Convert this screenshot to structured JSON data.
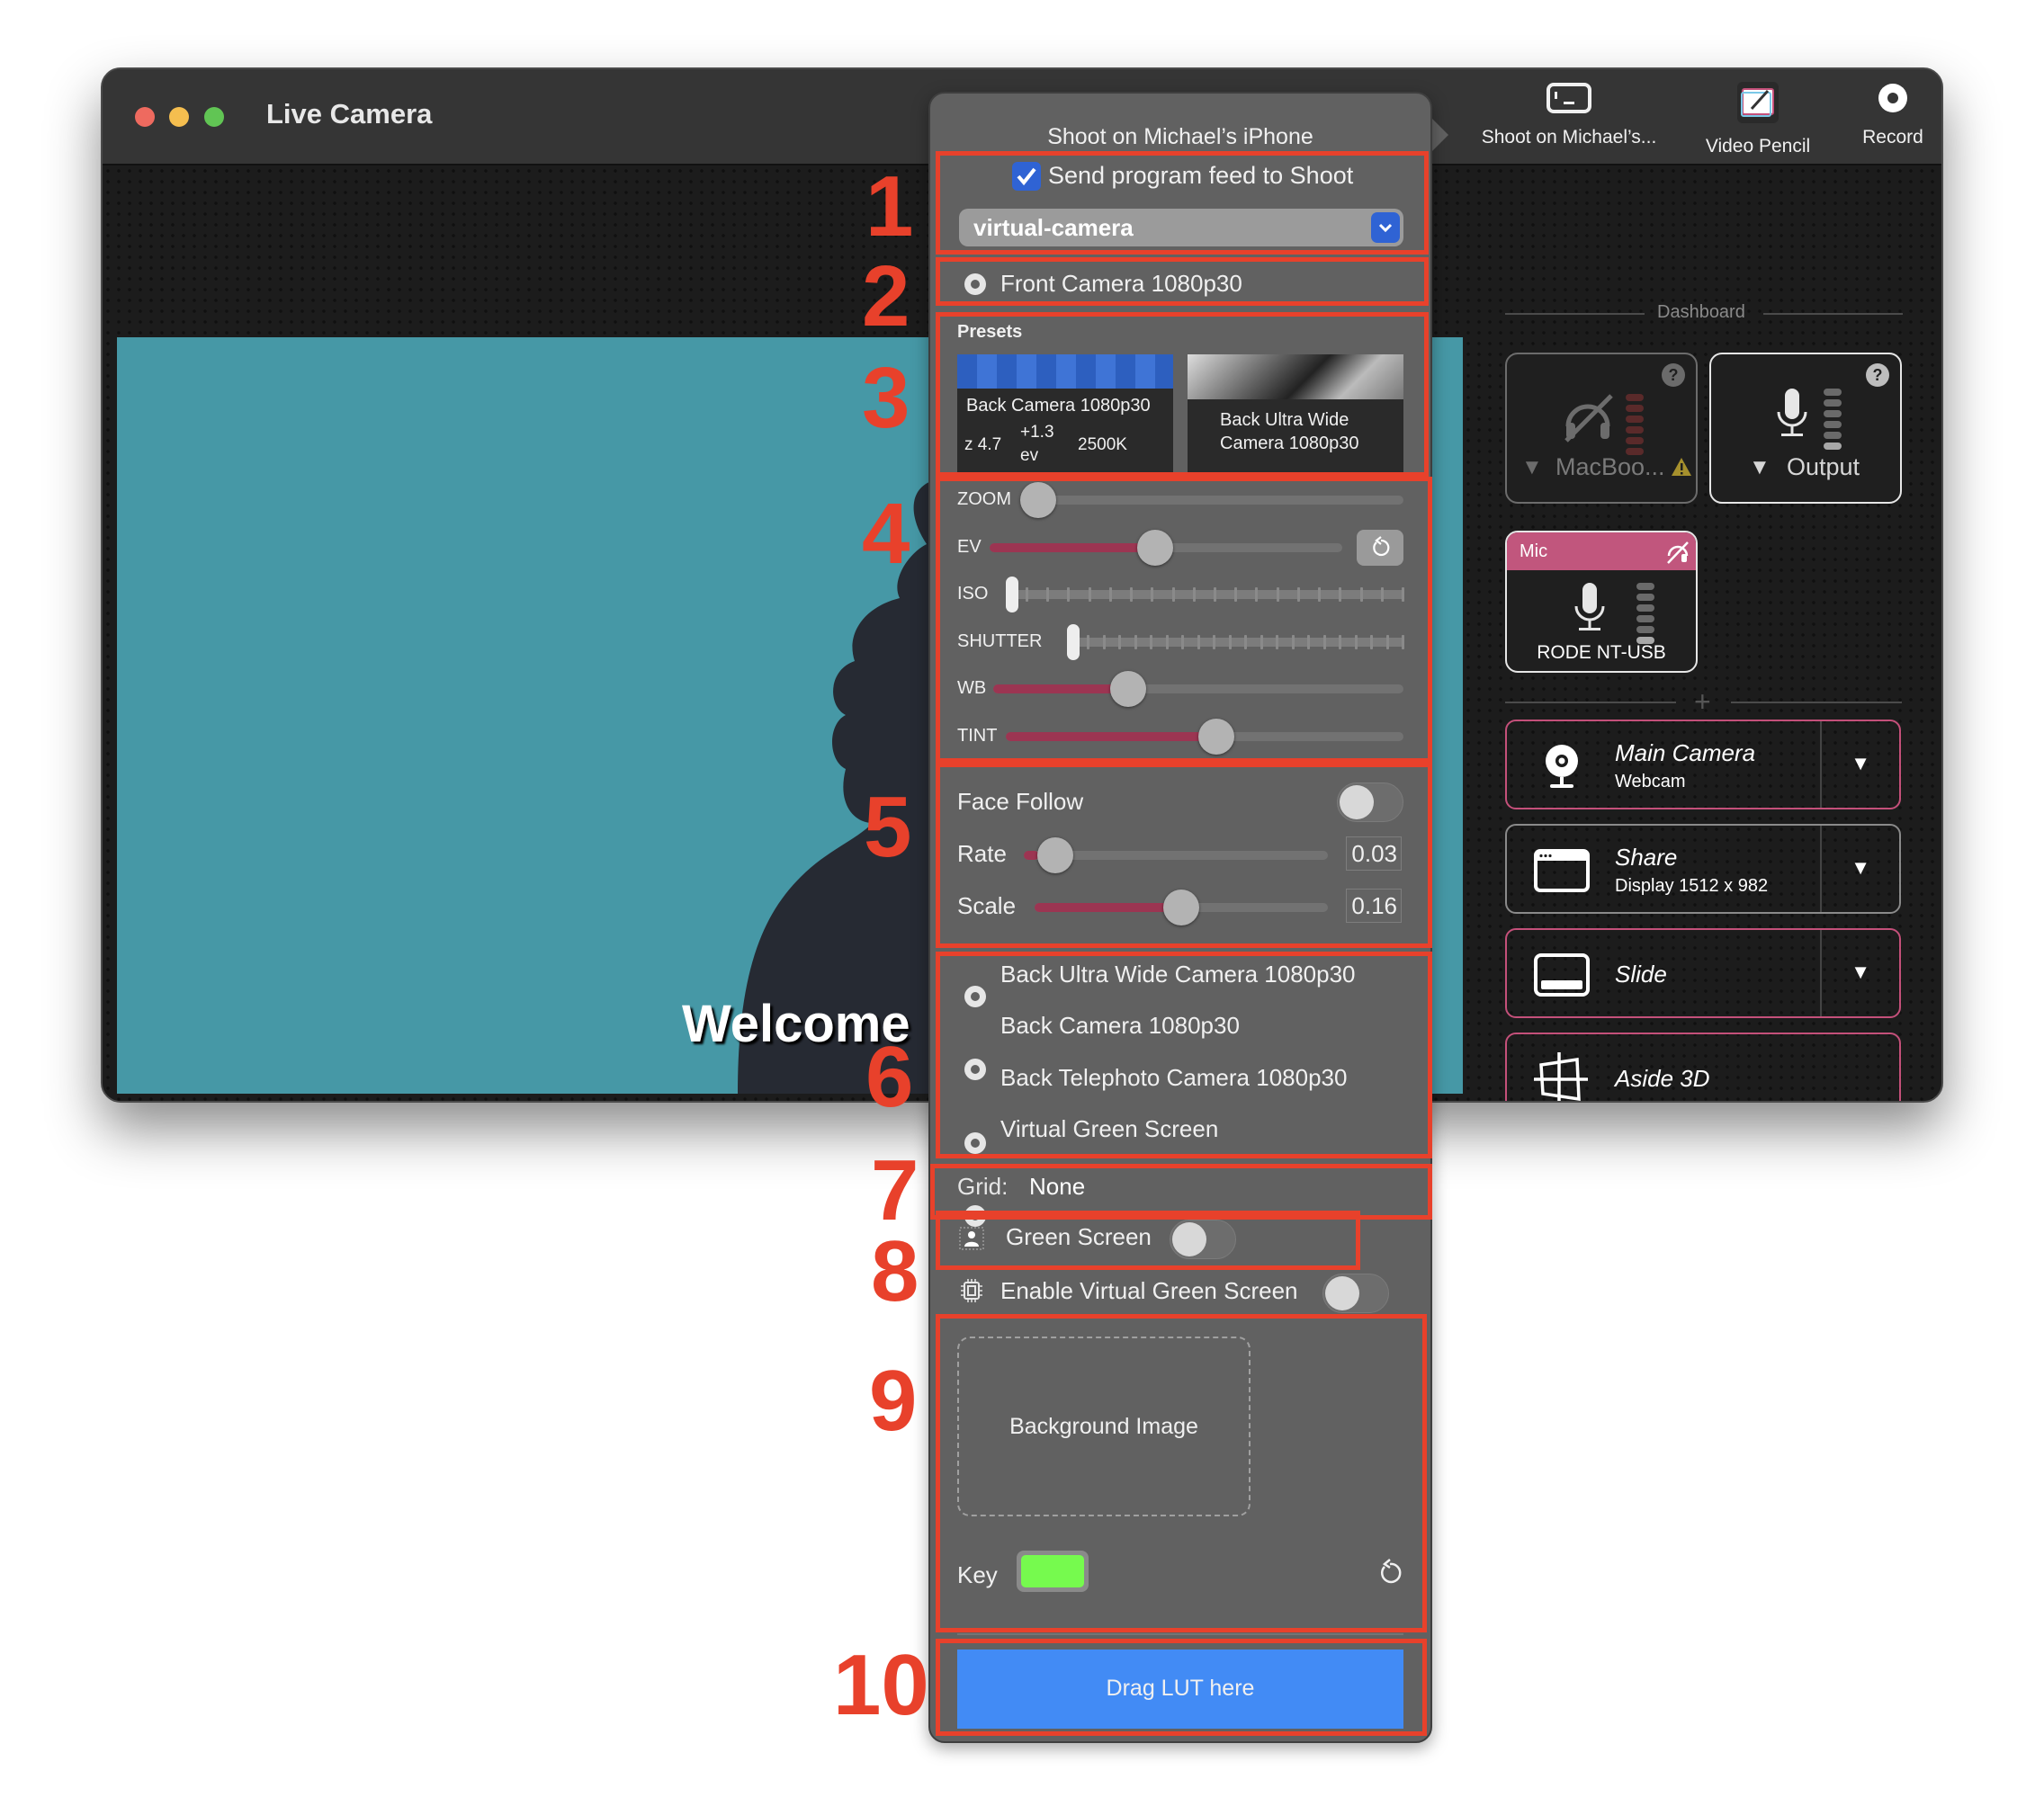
{
  "window": {
    "title": "Live Camera",
    "traffic_lights": {
      "close": "#ee6a5f",
      "minimize": "#f5be4f",
      "zoom": "#61c554"
    }
  },
  "toolbar": {
    "shoot": {
      "label": "Shoot on Michael’s...",
      "icon": "phone-landscape-icon"
    },
    "video_pencil": {
      "label": "Video Pencil",
      "icon": "video-pencil-icon"
    },
    "record": {
      "label": "Record",
      "icon": "record-icon"
    }
  },
  "preview": {
    "overlay_text": "Welcome",
    "background_color": "#4698a6",
    "silhouette_color": "#262a33"
  },
  "dashboard": {
    "header": "Dashboard",
    "audio_tiles": [
      {
        "name": "MacBoo...",
        "icon": "headphones-muted-icon",
        "warning": true,
        "help": "?",
        "state": "disabled"
      },
      {
        "name": "Output",
        "icon": "microphone-icon",
        "help": "?",
        "state": "active"
      }
    ],
    "mic_tile": {
      "header": "Mic",
      "device": "RODE NT-USB",
      "header_icon": "headphones-muted-icon"
    },
    "add_symbol": "+",
    "sources": [
      {
        "title": "Main Camera",
        "subtitle": "Webcam",
        "icon": "webcam-icon",
        "has_menu": true,
        "accent": "#c4507a"
      },
      {
        "title": "Share",
        "subtitle": "Display 1512 x 982",
        "icon": "window-icon",
        "has_menu": true,
        "accent": "#8a8a8a"
      },
      {
        "title": "Slide",
        "subtitle": "",
        "icon": "slide-icon",
        "has_menu": true,
        "accent": "#c4507a"
      },
      {
        "title": "Aside 3D",
        "subtitle": "",
        "icon": "perspective-grid-icon",
        "has_menu": false,
        "accent": "#c4507a"
      }
    ],
    "caret": "▼"
  },
  "popover": {
    "title": "Shoot on Michael’s iPhone",
    "send_feed": {
      "label": "Send program feed to Shoot",
      "checked": true
    },
    "output_select": {
      "value": "virtual-camera"
    },
    "front_camera": "Front Camera 1080p30",
    "presets": {
      "header": "Presets",
      "items": [
        {
          "title": "Back Camera 1080p30",
          "zoom": "z 4.7",
          "ev_value": "+1.3",
          "ev_unit": "ev",
          "wb": "2500K"
        },
        {
          "title_line1": "Back Ultra Wide",
          "title_line2": "Camera 1080p30"
        }
      ]
    },
    "sliders": [
      {
        "label": "ZOOM",
        "value": 0.0,
        "style": "plain"
      },
      {
        "label": "EV",
        "value": 0.47,
        "style": "filled",
        "reset": true
      },
      {
        "label": "ISO",
        "value": 0.0,
        "style": "ticks",
        "ticks": 19
      },
      {
        "label": "SHUTTER",
        "value": 0.0,
        "style": "ticks",
        "ticks": 21
      },
      {
        "label": "WB",
        "value": 0.33,
        "style": "filled"
      },
      {
        "label": "TINT",
        "value": 0.53,
        "style": "filled"
      }
    ],
    "face_follow": {
      "label": "Face Follow",
      "enabled": false,
      "rate": {
        "label": "Rate",
        "value": "0.03",
        "fraction": 0.05
      },
      "scale": {
        "label": "Scale",
        "value": "0.16",
        "fraction": 0.5
      }
    },
    "cameras": [
      "Back Ultra Wide Camera 1080p30",
      "Back Camera 1080p30",
      "Back Telephoto Camera 1080p30",
      "Virtual Green Screen"
    ],
    "grid": {
      "label": "Grid:",
      "value": "None"
    },
    "green_screen": {
      "label": "Green Screen",
      "enabled": false
    },
    "virtual_green_screen": {
      "label": "Enable Virtual Green Screen",
      "enabled": false
    },
    "background_image": {
      "label": "Background Image"
    },
    "key": {
      "label": "Key",
      "color": "#76fa4e"
    },
    "lut": {
      "label": "Drag LUT here",
      "color": "#428bf5"
    }
  },
  "annotations": [
    "1",
    "2",
    "3",
    "4",
    "5",
    "6",
    "7",
    "8",
    "9",
    "10"
  ]
}
